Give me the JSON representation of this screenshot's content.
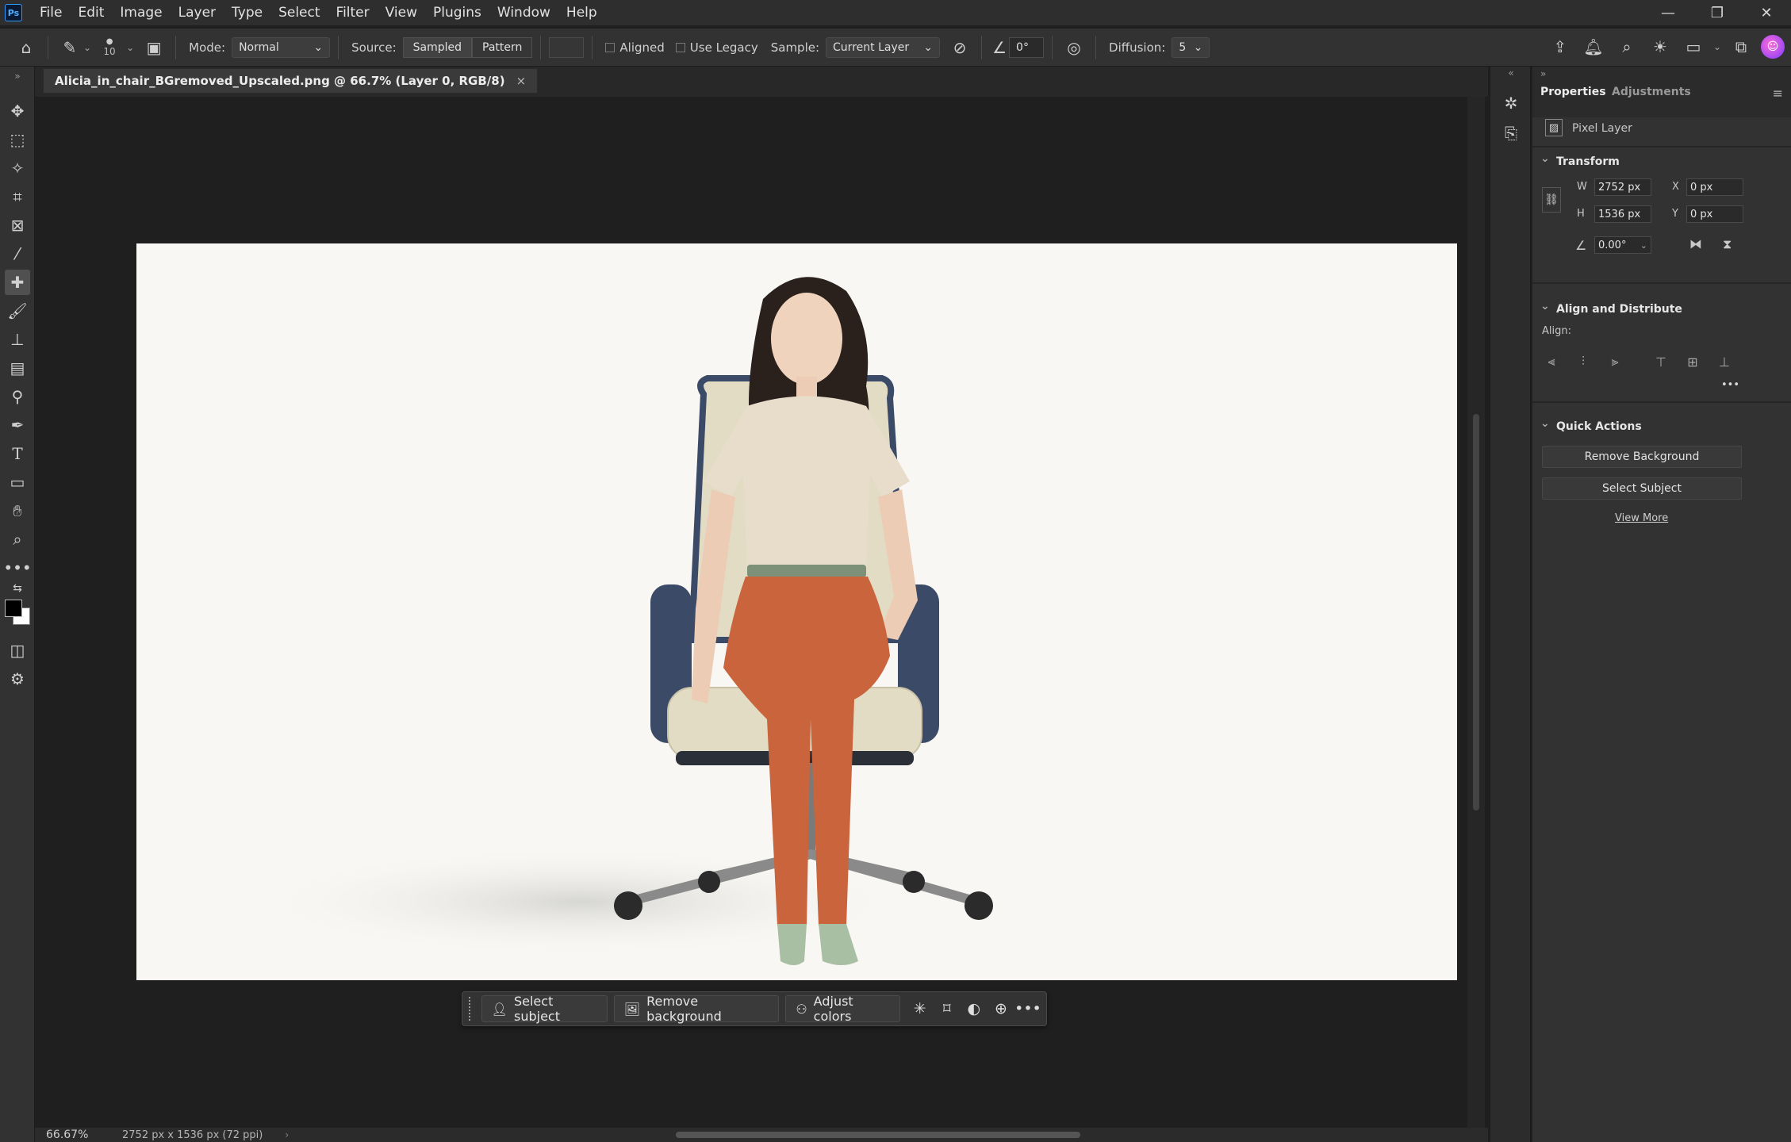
{
  "menubar": {
    "logo": "Ps",
    "items": [
      "File",
      "Edit",
      "Image",
      "Layer",
      "Type",
      "Select",
      "Filter",
      "View",
      "Plugins",
      "Window",
      "Help"
    ]
  },
  "options": {
    "brush_size": "10",
    "mode_label": "Mode:",
    "mode_value": "Normal",
    "source_label": "Source:",
    "source_sampled": "Sampled",
    "source_pattern": "Pattern",
    "aligned_label": "Aligned",
    "use_legacy_label": "Use Legacy",
    "sample_label": "Sample:",
    "sample_value": "Current Layer",
    "angle_value": "0°",
    "diffusion_label": "Diffusion:",
    "diffusion_value": "5"
  },
  "document": {
    "tab_title": "Alicia_in_chair_BGremoved_Upscaled.png @ 66.7% (Layer 0, RGB/8)",
    "close_symbol": "×"
  },
  "taskbar": {
    "select_subject": "Select subject",
    "remove_background": "Remove background",
    "adjust_colors": "Adjust colors",
    "more": "•••"
  },
  "status": {
    "zoom": "66.67%",
    "doc_info": "2752 px x 1536 px (72 ppi)"
  },
  "panel": {
    "tab_properties": "Properties",
    "tab_adjustments": "Adjustments",
    "layer_type": "Pixel Layer",
    "transform_title": "Transform",
    "w_label": "W",
    "w_value": "2752 px",
    "h_label": "H",
    "h_value": "1536 px",
    "x_label": "X",
    "x_value": "0 px",
    "y_label": "Y",
    "y_value": "0 px",
    "angle_value": "0.00°",
    "align_title": "Align and Distribute",
    "align_label": "Align:",
    "align_more": "•••",
    "quick_actions_title": "Quick Actions",
    "remove_background_btn": "Remove Background",
    "select_subject_btn": "Select Subject",
    "view_more": "View More"
  },
  "colors": {
    "shirt": "#e8dccb",
    "pants": "#c9643c",
    "chair": "#e3dcc4",
    "chair_side": "#3b4a66",
    "shoes": "#a9bfa3"
  }
}
